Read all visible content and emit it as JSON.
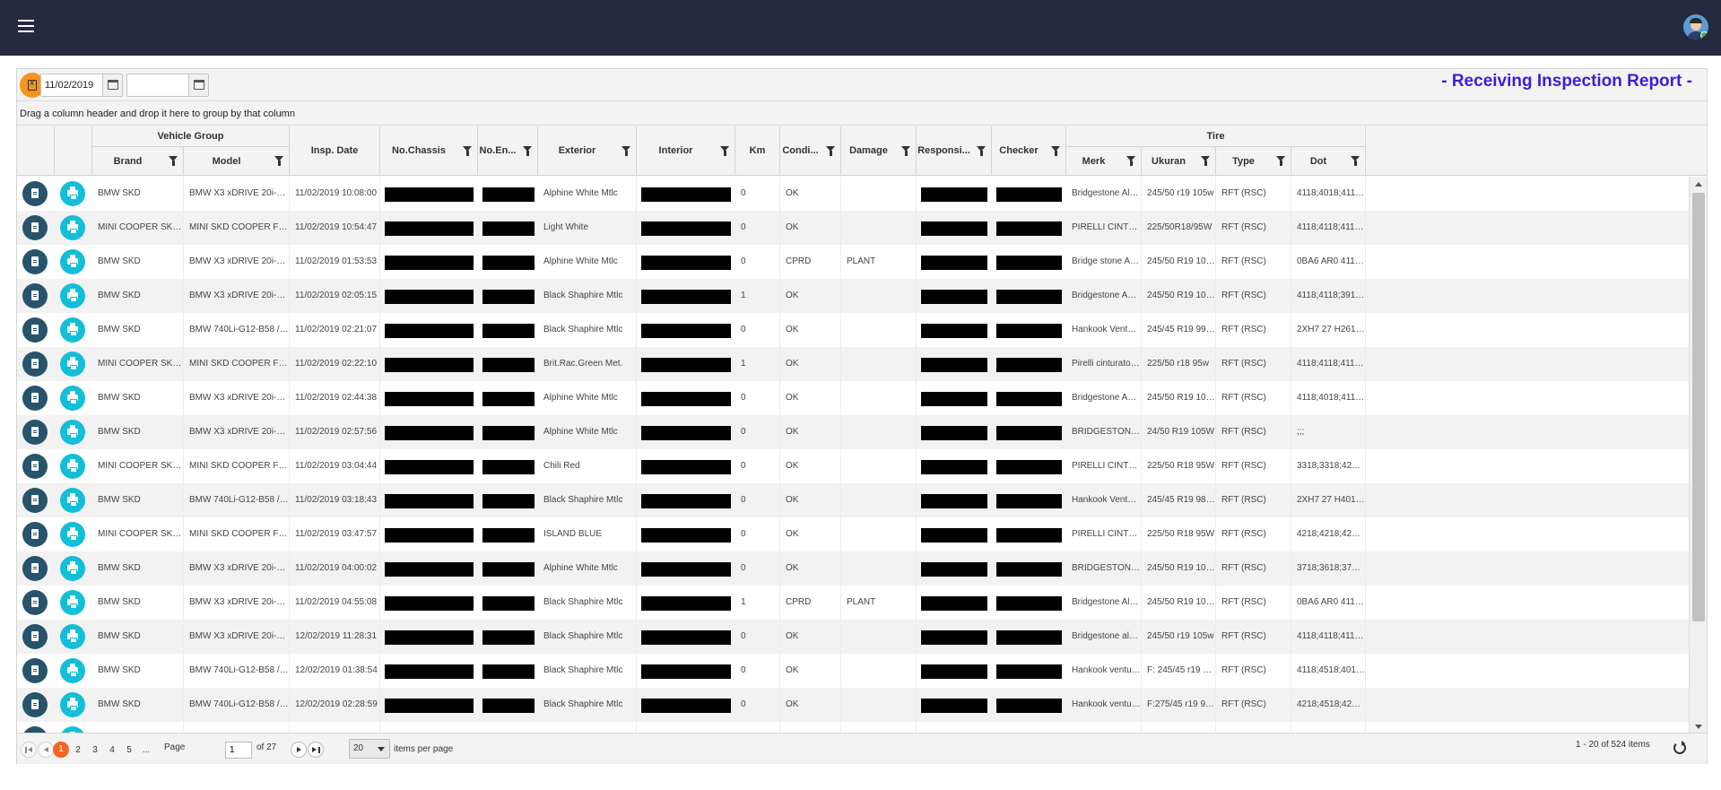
{
  "header": {
    "menu_icon": "hamburger-menu-icon",
    "avatar_icon": "user-avatar-icon"
  },
  "toolbar": {
    "export_icon": "excel-export-icon",
    "date_from": "11/02/2019",
    "date_to": "",
    "calendar_icon": "calendar-icon",
    "report_title": "- Receiving Inspection Report -"
  },
  "grouping_hint": "Drag a column header and drop it here to group by that column",
  "columns": {
    "vehicle_group": "Vehicle Group",
    "brand": "Brand",
    "model": "Model",
    "insp_date": "Insp. Date",
    "chassis": "No.Chassis",
    "engine": "No.En...",
    "exterior": "Exterior",
    "interior": "Interior",
    "km": "Km",
    "condition": "Condi...",
    "damage": "Damage",
    "responsible": "Responsi...",
    "checker": "Checker",
    "tire": "Tire",
    "merk": "Merk",
    "ukuran": "Ukuran",
    "type": "Type",
    "dot": "Dot"
  },
  "rows": [
    {
      "brand": "BMW SKD",
      "model": "BMW X3 xDRIVE 20i-G01...",
      "date": "11/02/2019 10:08:00",
      "exterior": "Alphine White Mtlc",
      "km": "0",
      "cond": "OK",
      "damage": "",
      "merk": "Bridgestone Ale...",
      "ukuran": "245/50 r19 105w",
      "type": "RFT (RSC)",
      "dot": "4118;4018;4118;..."
    },
    {
      "brand": "MINI COOPER SKD 1",
      "model": "MINI SKD COOPER F60 /...",
      "date": "11/02/2019 10:54:47",
      "exterior": "Light White",
      "km": "0",
      "cond": "OK",
      "damage": "",
      "merk": "PIRELLI CINTU...",
      "ukuran": "225/50R18/95W",
      "type": "RFT (RSC)",
      "dot": "4118;4118;4118;..."
    },
    {
      "brand": "BMW SKD",
      "model": "BMW X3 xDRIVE 20i-G01...",
      "date": "11/02/2019 01:53:53",
      "exterior": "Alphine White Mtlc",
      "km": "0",
      "cond": "CPRD",
      "damage": "PLANT",
      "merk": "Bridge stone Ale...",
      "ukuran": "245/50 R19 105W",
      "type": "RFT (RSC)",
      "dot": "0BA6 AR0 4118;..."
    },
    {
      "brand": "BMW SKD",
      "model": "BMW X3 xDRIVE 20i-G01...",
      "date": "11/02/2019 02:05:15",
      "exterior": "Black Shaphire Mtlc",
      "km": "1",
      "cond": "OK",
      "damage": "",
      "merk": "Bridgestone ALE...",
      "ukuran": "245/50 R19 105W",
      "type": "RFT (RSC)",
      "dot": "4118;4118;3918;..."
    },
    {
      "brand": "BMW SKD",
      "model": "BMW 740Li-G12-B58 / 7E...",
      "date": "11/02/2019 02:21:07",
      "exterior": "Black Shaphire Mtlc",
      "km": "0",
      "cond": "OK",
      "damage": "",
      "merk": "Hankook Ventus ...",
      "ukuran": "245/45 R19 99Y ...",
      "type": "RFT (RSC)",
      "dot": "2XH7 27 H2618;..."
    },
    {
      "brand": "MINI COOPER SKD 1",
      "model": "MINI SKD COOPER F60 /...",
      "date": "11/02/2019 02:22:10",
      "exterior": "Brit.Rac.Green Met.",
      "km": "1",
      "cond": "OK",
      "damage": "",
      "merk": "Pirelli cinturato p7",
      "ukuran": "225/50 r18 95w",
      "type": "RFT (RSC)",
      "dot": "4118;4118;4118;..."
    },
    {
      "brand": "BMW SKD",
      "model": "BMW X3 xDRIVE 20i-G01...",
      "date": "11/02/2019 02:44:38",
      "exterior": "Alphine White Mtlc",
      "km": "0",
      "cond": "OK",
      "damage": "",
      "merk": "Bridgestone ALE...",
      "ukuran": "245/50 R19 105 W",
      "type": "RFT (RSC)",
      "dot": "4118;4018;4118;..."
    },
    {
      "brand": "BMW SKD",
      "model": "BMW X3 xDRIVE 20i-G01...",
      "date": "11/02/2019 02:57:56",
      "exterior": "Alphine White Mtlc",
      "km": "0",
      "cond": "OK",
      "damage": "",
      "merk": "BRIDGESTONE ...",
      "ukuran": "24/50 R19 105W",
      "type": "RFT (RSC)",
      "dot": ";;;"
    },
    {
      "brand": "MINI COOPER SKD 1",
      "model": "MINI SKD COOPER F60 /...",
      "date": "11/02/2019 03:04:44",
      "exterior": "Chili Red",
      "km": "0",
      "cond": "OK",
      "damage": "",
      "merk": "PIRELLI CINTU...",
      "ukuran": "225/50 R18 95W",
      "type": "RFT (RSC)",
      "dot": "3318;3318;4218;..."
    },
    {
      "brand": "BMW SKD",
      "model": "BMW 740Li-G12-B58 / 7E...",
      "date": "11/02/2019 03:18:43",
      "exterior": "Black Shaphire Mtlc",
      "km": "0",
      "cond": "OK",
      "damage": "",
      "merk": "Hankook Ventus ...",
      "ukuran": "245/45 R19 98Y ...",
      "type": "RFT (RSC)",
      "dot": "2XH7 27 H4018;..."
    },
    {
      "brand": "MINI COOPER SKD 1",
      "model": "MINI SKD COOPER F60 /...",
      "date": "11/02/2019 03:47:57",
      "exterior": "ISLAND BLUE",
      "km": "0",
      "cond": "OK",
      "damage": "",
      "merk": "PIRELLI CINTU...",
      "ukuran": "225/50 R18 95W",
      "type": "RFT (RSC)",
      "dot": "4218;4218;4218;..."
    },
    {
      "brand": "BMW SKD",
      "model": "BMW X3 xDRIVE 20i-G01...",
      "date": "11/02/2019 04:00:02",
      "exterior": "Alphine White Mtlc",
      "km": "0",
      "cond": "OK",
      "damage": "",
      "merk": "BRIDGESTONE ...",
      "ukuran": "245/50 R19 105W",
      "type": "RFT (RSC)",
      "dot": "3718;3618;3718;..."
    },
    {
      "brand": "BMW SKD",
      "model": "BMW X3 xDRIVE 20i-G01...",
      "date": "11/02/2019 04:55:08",
      "exterior": "Black Shaphire Mtlc",
      "km": "1",
      "cond": "CPRD",
      "damage": "PLANT",
      "merk": "Bridgestone Ale...",
      "ukuran": "245/50 R19 105W",
      "type": "RFT (RSC)",
      "dot": "0BA6 AR0 4118;..."
    },
    {
      "brand": "BMW SKD",
      "model": "BMW X3 xDRIVE 20i-G01...",
      "date": "12/02/2019 11:28:31",
      "exterior": "Black Shaphire Mtlc",
      "km": "0",
      "cond": "OK",
      "damage": "",
      "merk": "Bridgestone alenza",
      "ukuran": "245/50 r19 105w",
      "type": "RFT (RSC)",
      "dot": "4118;4118;4118;..."
    },
    {
      "brand": "BMW SKD",
      "model": "BMW 740Li-G12-B58 / 7E...",
      "date": "12/02/2019 01:38:54",
      "exterior": "Black Shaphire Mtlc",
      "km": "0",
      "cond": "OK",
      "damage": "",
      "merk": "Hankook ventus ...",
      "ukuran": "F: 245/45 r19 98...",
      "type": "RFT (RSC)",
      "dot": "4118;4518;4018;..."
    },
    {
      "brand": "BMW SKD",
      "model": "BMW 740Li-G12-B58 / 7E...",
      "date": "12/02/2019 02:28:59",
      "exterior": "Black Shaphire Mtlc",
      "km": "0",
      "cond": "OK",
      "damage": "",
      "merk": "Hankook ventus ...",
      "ukuran": "F:275/45 r19 98y...",
      "type": "RFT (RSC)",
      "dot": "4218;4518;4218;..."
    },
    {
      "brand": "",
      "model": "",
      "date": "",
      "exterior": "",
      "km": "",
      "cond": "",
      "damage": "",
      "merk": "",
      "ukuran": "",
      "type": "",
      "dot": ""
    }
  ],
  "pager": {
    "pages": [
      "1",
      "2",
      "3",
      "4",
      "5",
      "..."
    ],
    "page_label": "Page",
    "current_page": "1",
    "of_label": "of 27",
    "page_size": "20",
    "per_page_label": "items per page",
    "summary": "1 - 20 of 524 items",
    "refresh_icon": "refresh-icon"
  }
}
